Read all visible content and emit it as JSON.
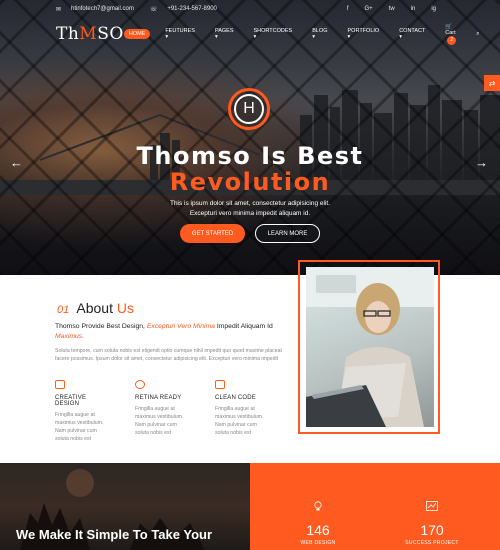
{
  "topbar": {
    "email": "htinfotech7@gmail.com",
    "phone": "+91-234-567-8900",
    "social": [
      "f",
      "G+",
      "tw",
      "in",
      "ig"
    ]
  },
  "nav": {
    "logo_left": "Th",
    "logo_mark": "M",
    "logo_right": "SO",
    "items": [
      "HOME",
      "FEUTURES ▾",
      "PAGES ▾",
      "SHORTCODES ▾",
      "BLOG ▾",
      "PORTFOLIO ▾",
      "CONTACT ▾"
    ],
    "cart_label": "Cart",
    "cart_count": "2"
  },
  "hero": {
    "badge_letter": "H",
    "title": "Thomso Is Best",
    "subtitle": "Revolution",
    "text1": "This is ipsum dolor sit amet, consectetur adipisicing elit.",
    "text2": "Excepturi vero minima impedit aliquam id.",
    "btn_primary": "GET STARTED",
    "btn_secondary": "LEARN MORE"
  },
  "about": {
    "number": "01",
    "title_a": "About",
    "title_b": "Us",
    "lead_a": "Thomso Provide Best Design,",
    "lead_hl": "Excepturi Vero Minima",
    "lead_b": "Impedit Aliquam Id",
    "lead_hl2": "Maximus.",
    "body": "Soluta tempore, cum soluta nobis est eligendi optio cumque nihil impedit quo quod maxime placeat facere possimus. Ipsum dolor sit amet, consectetur adipisicing elit. Excepturi vero minima impedit",
    "features": [
      {
        "title": "CREATIVE DESIGN",
        "desc": "Fringilla augue at maximus vestibulum. Nam pulvinar cum soluta nobis est"
      },
      {
        "title": "RETINA READY",
        "desc": "Fringilla augue at maximus vestibulum. Nam pulvinar cum soluta nobis est"
      },
      {
        "title": "CLEAN CODE",
        "desc": "Fringilla augue at maximus vestibulum. Nam pulvinar cum soluta nobis est"
      }
    ]
  },
  "bottom": {
    "headline": "We Make It Simple To Take Your",
    "stats": [
      {
        "value": "146",
        "label": "WEB DESIGN"
      },
      {
        "value": "170",
        "label": "SUCCESS PROJECT"
      }
    ]
  },
  "colors": {
    "accent": "#ff5a1f"
  }
}
